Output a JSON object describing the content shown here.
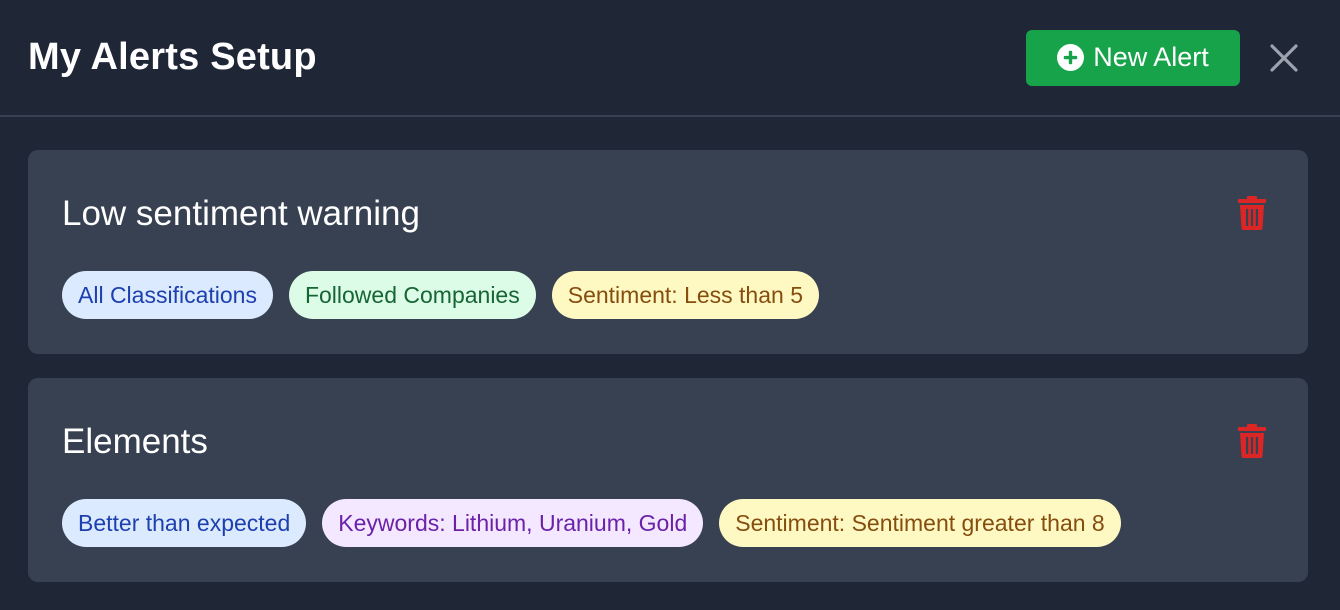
{
  "header": {
    "title": "My Alerts Setup",
    "new_alert_label": "New Alert"
  },
  "alerts": [
    {
      "name": "Low sentiment warning",
      "tags": [
        {
          "label": "All Classifications",
          "color": "blue"
        },
        {
          "label": "Followed Companies",
          "color": "green"
        },
        {
          "label": "Sentiment: Less than 5",
          "color": "yellow"
        }
      ]
    },
    {
      "name": "Elements",
      "tags": [
        {
          "label": "Better than expected",
          "color": "blue"
        },
        {
          "label": "Keywords: Lithium, Uranium, Gold",
          "color": "purple"
        },
        {
          "label": "Sentiment: Sentiment greater than 8",
          "color": "yellow"
        }
      ]
    }
  ],
  "colors": {
    "background": "#1f2737",
    "card": "#374151",
    "accent_green": "#17a34a",
    "delete_red": "#dc2626"
  },
  "icons": {
    "new_alert": "plus-circle-icon",
    "close": "close-icon",
    "delete": "trash-icon"
  }
}
